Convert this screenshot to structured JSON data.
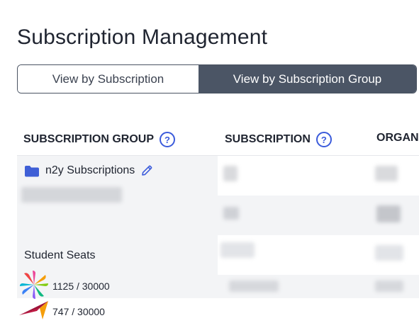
{
  "page": {
    "title": "Subscription Management"
  },
  "view_toggle": {
    "options": [
      {
        "label": "View by Subscription",
        "selected": false
      },
      {
        "label": "View by Subscription Group",
        "selected": true
      }
    ]
  },
  "table": {
    "columns": [
      {
        "label": "SUBSCRIPTION GROUP",
        "has_help": true
      },
      {
        "label": "SUBSCRIPTION",
        "has_help": true
      },
      {
        "label": "ORGAN",
        "has_help": false
      }
    ],
    "help_glyph": "?",
    "group": {
      "name": "n2y Subscriptions",
      "icon": "folder-icon",
      "section_label": "Student Seats",
      "seats": [
        {
          "icon": "colorful-pinwheel-logo-icon",
          "usage": "1125 / 30000"
        },
        {
          "icon": "red-arrow-logo-icon",
          "usage": "747 / 30000"
        }
      ]
    }
  },
  "colors": {
    "accent": "#3b5bdb",
    "toggle_selected_bg": "#4b5565",
    "row_alt_bg": "#f3f4f6",
    "folder": "#3f5fd6"
  }
}
